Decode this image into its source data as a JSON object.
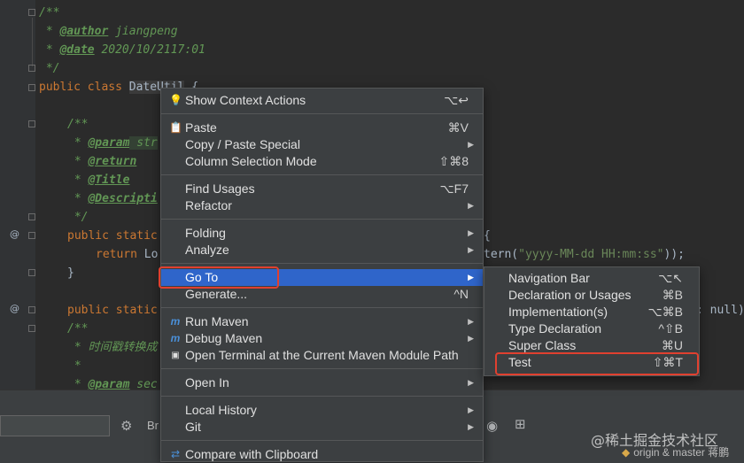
{
  "editor": {
    "lines": {
      "l1": "/**",
      "l2_tag": "@author",
      "l2_text": " jiangpeng",
      "l3_tag": "@date",
      "l3_text": " 2020/10/2117:01",
      "l4": " */",
      "l5_kw": "public class ",
      "l5_cls": "DateUtil",
      "l5_rest": " {",
      "l7": "/**",
      "l8_tag": "@param",
      "l8_text": " str",
      "l9_tag": "@return",
      "l10_tag": "@Title",
      "l11_tag": "@Descripti",
      "l12": " */",
      "l13_kw": "public static",
      "l13_tail": "{",
      "l14_kw": "return",
      "l14_plain": " Lo",
      "l14_tail_plain": "tern(",
      "l14_str": "\"yyyy-MM-dd HH:mm:ss\"",
      "l14_end": "));",
      "l15": "}",
      "l17_kw": "public static",
      "l17_tail": ": null)",
      "l18": "/**",
      "l19": " * 时间戳转换成",
      "l20": " *",
      "l21_tag": "@param",
      "l21_text": " sec"
    },
    "gutter_marks": [
      "@",
      "@"
    ]
  },
  "context_menu": {
    "items": [
      {
        "icon": "bulb-icon",
        "label": "Show Context Actions",
        "shortcut": "⌥↩"
      },
      {
        "icon": "paste-icon",
        "label": "Paste",
        "shortcut": "⌘V"
      },
      {
        "label": "Copy / Paste Special",
        "submenu": true
      },
      {
        "label": "Column Selection Mode",
        "shortcut": "⇧⌘8"
      },
      {
        "label": "Find Usages",
        "shortcut": "⌥F7"
      },
      {
        "label": "Refactor",
        "submenu": true
      },
      {
        "label": "Folding",
        "submenu": true
      },
      {
        "label": "Analyze",
        "submenu": true
      },
      {
        "label": "Go To",
        "submenu": true,
        "selected": true
      },
      {
        "label": "Generate...",
        "shortcut": "^N"
      },
      {
        "icon": "maven-icon",
        "label": "Run Maven",
        "submenu": true
      },
      {
        "icon": "maven-icon",
        "label": "Debug Maven",
        "submenu": true
      },
      {
        "icon": "terminal-icon",
        "label": "Open Terminal at the Current Maven Module Path"
      },
      {
        "label": "Open In",
        "submenu": true
      },
      {
        "label": "Local History",
        "submenu": true
      },
      {
        "label": "Git",
        "submenu": true
      },
      {
        "icon": "compare-icon",
        "label": "Compare with Clipboard"
      }
    ]
  },
  "goto_submenu": {
    "items": [
      {
        "label": "Navigation Bar",
        "shortcut": "⌥↖"
      },
      {
        "label": "Declaration or Usages",
        "shortcut": "⌘B"
      },
      {
        "label": "Implementation(s)",
        "shortcut": "⌥⌘B"
      },
      {
        "label": "Type Declaration",
        "shortcut": "^⇧B"
      },
      {
        "label": "Super Class",
        "shortcut": "⌘U"
      },
      {
        "label": "Test",
        "shortcut": "⇧⌘T"
      }
    ]
  },
  "bottom_bar": {
    "branch_text": "Br",
    "watermark": "@稀土掘金技术社区",
    "vcs_status": "origin & master",
    "vcs_extra": "蒋鹏"
  },
  "colors": {
    "menu_bg": "#3c3f41",
    "selected_bg": "#2f65ca",
    "highlight_box": "#e0402f"
  }
}
